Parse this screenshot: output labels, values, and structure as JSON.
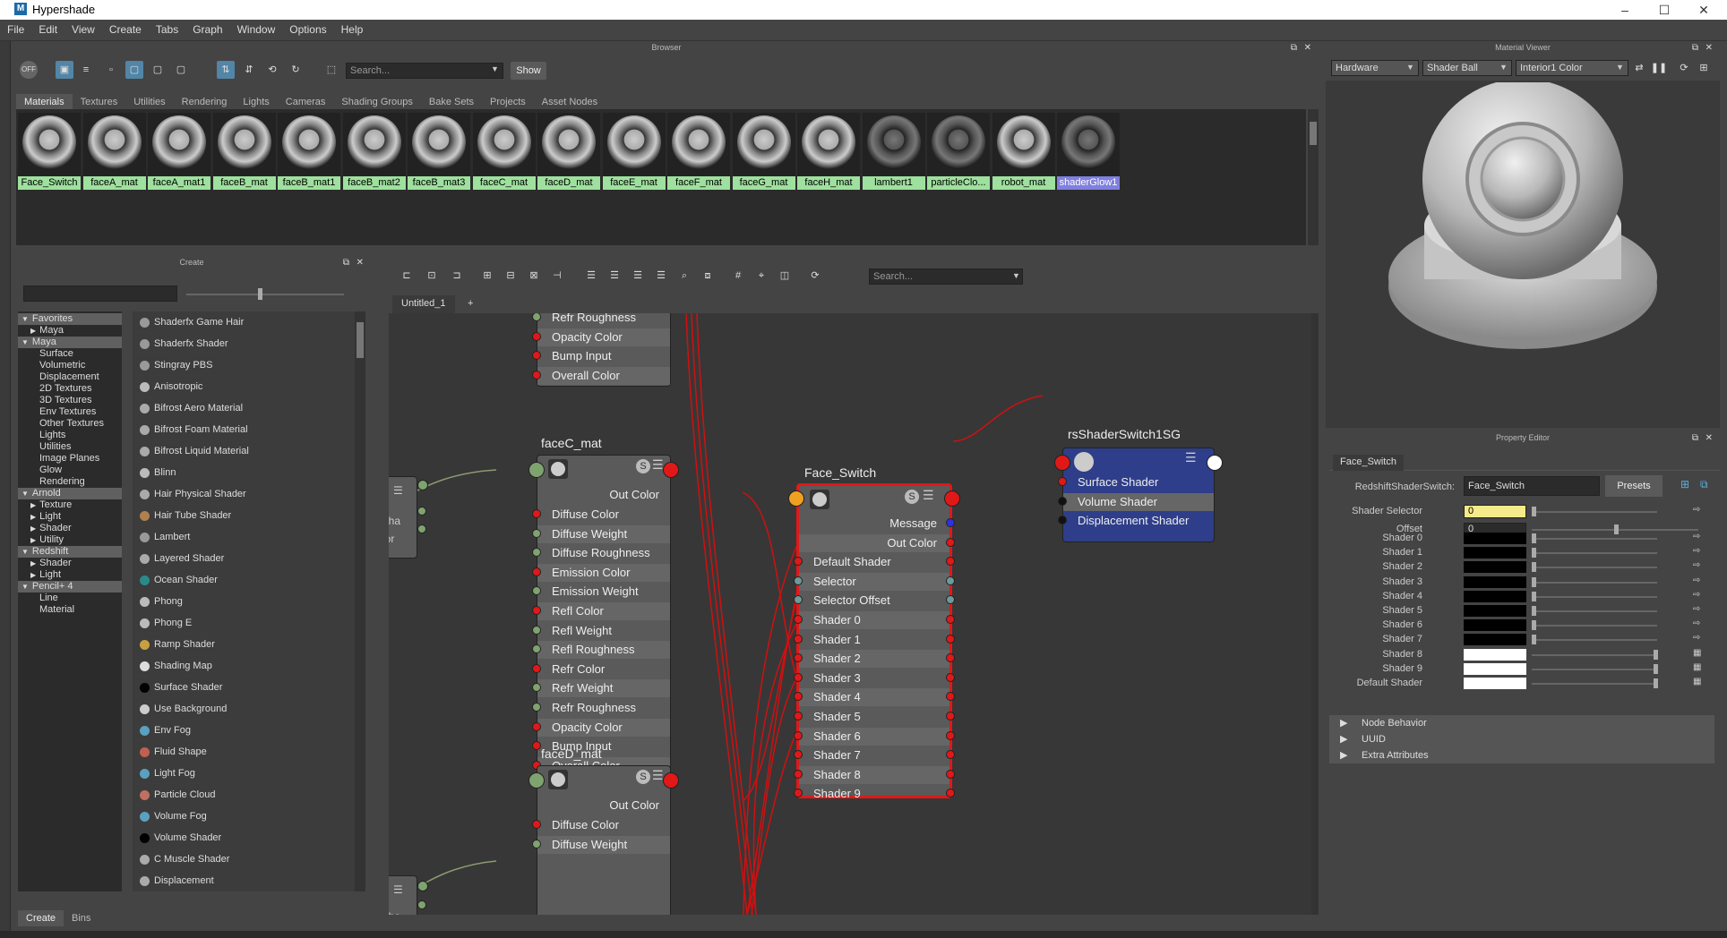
{
  "window": {
    "title": "Hypershade",
    "logo_letter": "M"
  },
  "menu": [
    "File",
    "Edit",
    "View",
    "Create",
    "Tabs",
    "Graph",
    "Window",
    "Options",
    "Help"
  ],
  "browser": {
    "header": "Browser",
    "search_placeholder": "Search...",
    "show_label": "Show",
    "off_label": "OFF",
    "tabs": [
      "Materials",
      "Textures",
      "Utilities",
      "Rendering",
      "Lights",
      "Cameras",
      "Shading Groups",
      "Bake Sets",
      "Projects",
      "Asset Nodes"
    ],
    "materials": [
      "Face_Switch",
      "faceA_mat",
      "faceA_mat1",
      "faceB_mat",
      "faceB_mat1",
      "faceB_mat2",
      "faceB_mat3",
      "faceC_mat",
      "faceD_mat",
      "faceE_mat",
      "faceF_mat",
      "faceG_mat",
      "faceH_mat",
      "lambert1",
      "particleClo...",
      "robot_mat",
      "shaderGlow1"
    ]
  },
  "create": {
    "header": "Create",
    "tree": [
      {
        "label": "Favorites",
        "sec": true,
        "arrow": "▼"
      },
      {
        "label": "Maya",
        "indent": 1,
        "arrow": "▶"
      },
      {
        "label": "Maya",
        "sec": true,
        "arrow": "▼"
      },
      {
        "label": "Surface",
        "indent": 2
      },
      {
        "label": "Volumetric",
        "indent": 2
      },
      {
        "label": "Displacement",
        "indent": 2
      },
      {
        "label": "2D Textures",
        "indent": 2
      },
      {
        "label": "3D Textures",
        "indent": 2
      },
      {
        "label": "Env Textures",
        "indent": 2
      },
      {
        "label": "Other Textures",
        "indent": 2
      },
      {
        "label": "Lights",
        "indent": 2
      },
      {
        "label": "Utilities",
        "indent": 2
      },
      {
        "label": "Image Planes",
        "indent": 2
      },
      {
        "label": "Glow",
        "indent": 2
      },
      {
        "label": "Rendering",
        "indent": 2
      },
      {
        "label": "Arnold",
        "sec": true,
        "arrow": "▼"
      },
      {
        "label": "Texture",
        "indent": 1,
        "arrow": "▶"
      },
      {
        "label": "Light",
        "indent": 1,
        "arrow": "▶"
      },
      {
        "label": "Shader",
        "indent": 1,
        "arrow": "▶"
      },
      {
        "label": "Utility",
        "indent": 1,
        "arrow": "▶"
      },
      {
        "label": "Redshift",
        "sec": true,
        "arrow": "▼"
      },
      {
        "label": "Shader",
        "indent": 1,
        "arrow": "▶"
      },
      {
        "label": "Light",
        "indent": 1,
        "arrow": "▶"
      },
      {
        "label": "Pencil+ 4",
        "sec": true,
        "arrow": "▼"
      },
      {
        "label": "Line",
        "indent": 2
      },
      {
        "label": "Material",
        "indent": 2
      }
    ],
    "items": [
      {
        "label": "Shaderfx Game Hair",
        "color": "#999"
      },
      {
        "label": "Shaderfx Shader",
        "color": "#999"
      },
      {
        "label": "Stingray PBS",
        "color": "#999"
      },
      {
        "label": "Anisotropic",
        "color": "#bbb"
      },
      {
        "label": "Bifrost Aero Material",
        "color": "#aaa"
      },
      {
        "label": "Bifrost Foam Material",
        "color": "#aaa"
      },
      {
        "label": "Bifrost Liquid Material",
        "color": "#aaa"
      },
      {
        "label": "Blinn",
        "color": "#bbb"
      },
      {
        "label": "Hair Physical Shader",
        "color": "#aaa"
      },
      {
        "label": "Hair Tube Shader",
        "color": "#b08050"
      },
      {
        "label": "Lambert",
        "color": "#999"
      },
      {
        "label": "Layered Shader",
        "color": "#aaa"
      },
      {
        "label": "Ocean Shader",
        "color": "#2a8a8a"
      },
      {
        "label": "Phong",
        "color": "#bbb"
      },
      {
        "label": "Phong E",
        "color": "#bbb"
      },
      {
        "label": "Ramp Shader",
        "color": "#c8a040"
      },
      {
        "label": "Shading Map",
        "color": "#ddd"
      },
      {
        "label": "Surface Shader",
        "color": "#000"
      },
      {
        "label": "Use Background",
        "color": "#ccc"
      },
      {
        "label": "Env Fog",
        "color": "#5aa0c0"
      },
      {
        "label": "Fluid Shape",
        "color": "#c06050"
      },
      {
        "label": "Light Fog",
        "color": "#5aa0c0"
      },
      {
        "label": "Particle Cloud",
        "color": "#c07060"
      },
      {
        "label": "Volume Fog",
        "color": "#5aa0c0"
      },
      {
        "label": "Volume Shader",
        "color": "#000"
      },
      {
        "label": "C Muscle Shader",
        "color": "#aaa"
      },
      {
        "label": "Displacement",
        "color": "#aaa"
      }
    ],
    "bottom_tabs": [
      "Create",
      "Bins"
    ]
  },
  "graph": {
    "tab": "Untitled_1",
    "add_tab": "+",
    "search_placeholder": "Search...",
    "top_node_rows": [
      "Refr Roughness",
      "Opacity Color",
      "Bump Input",
      "Overall Color"
    ],
    "faceC": {
      "title": "faceC_mat",
      "out": "Out Color",
      "rows": [
        "Diffuse Color",
        "Diffuse Weight",
        "Diffuse Roughness",
        "Emission Color",
        "Emission Weight",
        "Refl Color",
        "Refl Weight",
        "Refl Roughness",
        "Refr Color",
        "Refr Weight",
        "Refr Roughness",
        "Opacity Color",
        "Bump Input",
        "Overall Color"
      ]
    },
    "faceD": {
      "title": "faceD_mat",
      "out": "Out Color",
      "rows": [
        "Diffuse Color",
        "Diffuse Weight"
      ]
    },
    "left_partial": [
      "pha",
      "lor"
    ],
    "switch": {
      "title": "Face_Switch",
      "rows": [
        "Message",
        "Out Color",
        "Default Shader",
        "Selector",
        "Selector Offset",
        "Shader 0",
        "Shader 1",
        "Shader 2",
        "Shader 3",
        "Shader 4",
        "Shader 5",
        "Shader 6",
        "Shader 7",
        "Shader 8",
        "Shader 9"
      ]
    },
    "sg": {
      "title": "rsShaderSwitch1SG",
      "rows": [
        "Surface Shader",
        "Volume Shader",
        "Displacement Shader"
      ]
    }
  },
  "viewer": {
    "header": "Material Viewer",
    "renderer": "Hardware",
    "geometry": "Shader Ball",
    "environment": "Interior1 Color"
  },
  "property": {
    "header": "Property Editor",
    "tab": "Face_Switch",
    "type_label": "RedshiftShaderSwitch:",
    "name": "Face_Switch",
    "presets": "Presets",
    "rows": [
      {
        "label": "Shader Selector",
        "value": "0",
        "kind": "yellow"
      },
      {
        "label": "Offset",
        "value": "0",
        "kind": "field"
      },
      {
        "label": "Shader 0",
        "kind": "black"
      },
      {
        "label": "Shader 1",
        "kind": "black"
      },
      {
        "label": "Shader 2",
        "kind": "black"
      },
      {
        "label": "Shader 3",
        "kind": "black"
      },
      {
        "label": "Shader 4",
        "kind": "black"
      },
      {
        "label": "Shader 5",
        "kind": "black"
      },
      {
        "label": "Shader 6",
        "kind": "black"
      },
      {
        "label": "Shader 7",
        "kind": "black"
      },
      {
        "label": "Shader 8",
        "kind": "white"
      },
      {
        "label": "Shader 9",
        "kind": "white"
      },
      {
        "label": "Default Shader",
        "kind": "white"
      }
    ],
    "sections": [
      "Node Behavior",
      "UUID",
      "Extra Attributes"
    ]
  },
  "colors": {
    "selected_blue": "#5285a6",
    "swatch_green": "#9ee09e",
    "connection_red": "#e01818",
    "switch_border": "#e01818",
    "sg_blue": "#2e3e8a"
  }
}
